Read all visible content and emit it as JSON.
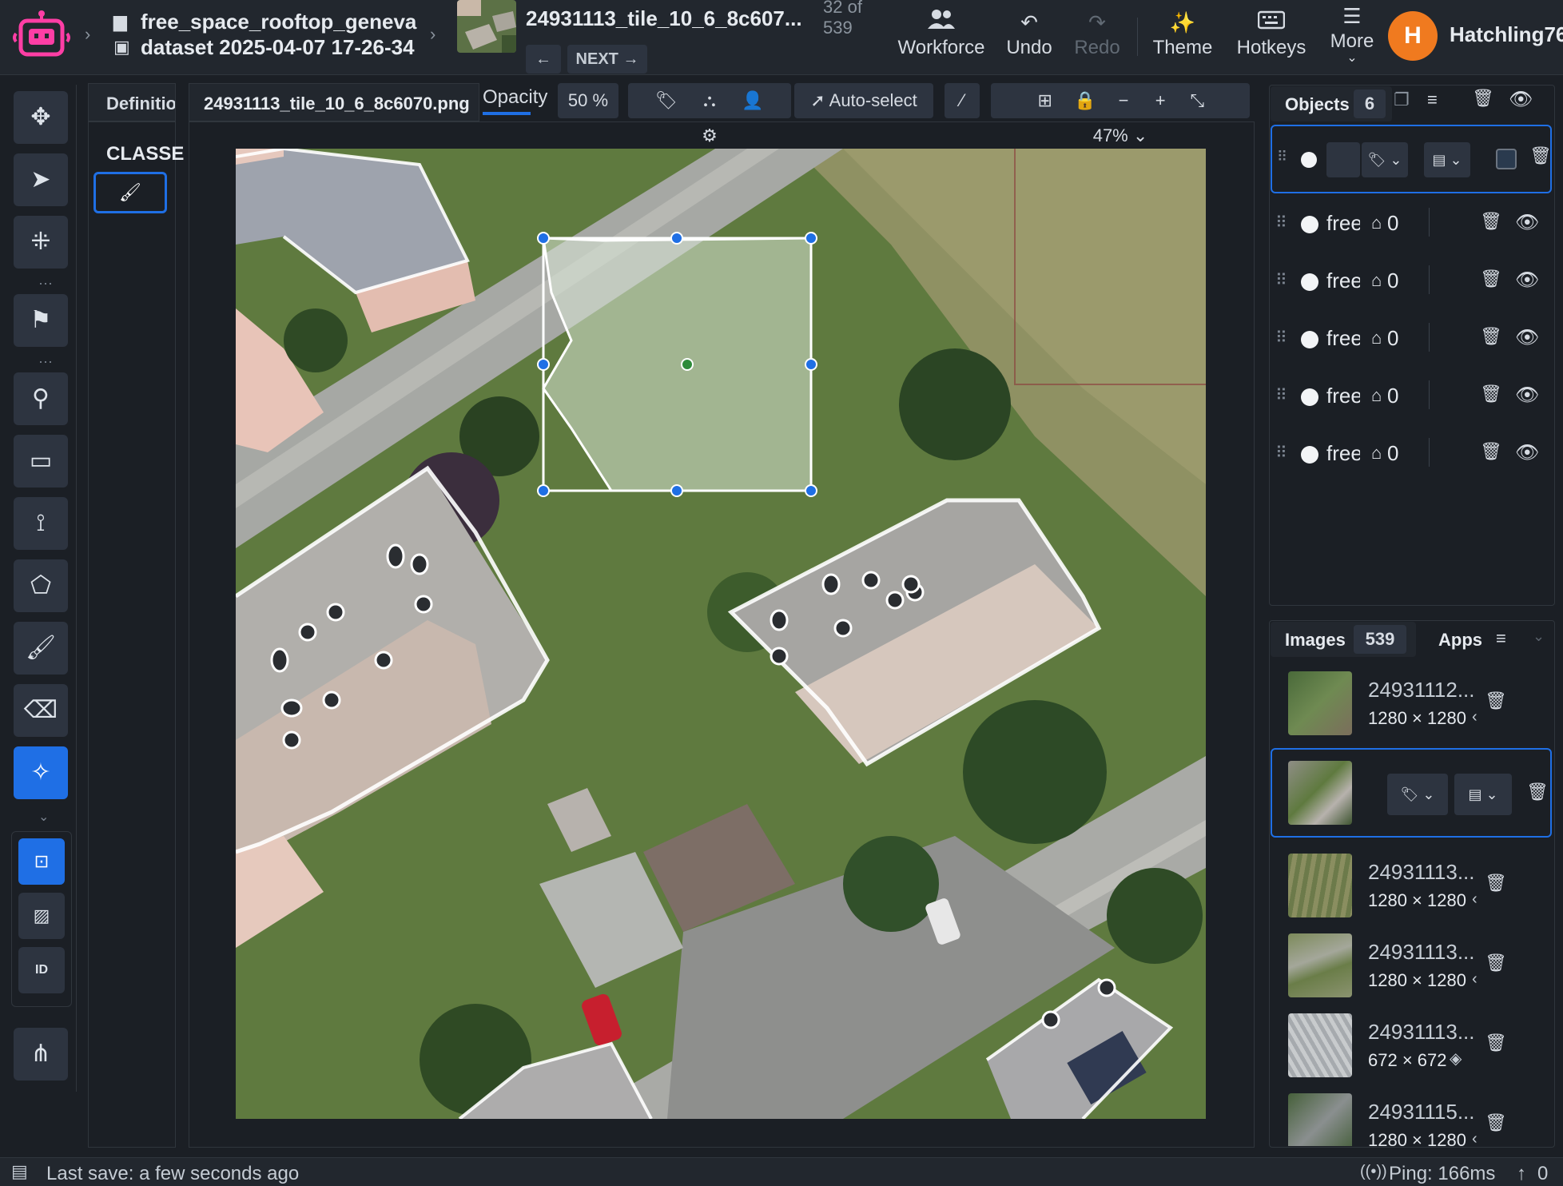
{
  "header": {
    "project": "free_space_rooftop_geneva",
    "dataset": "dataset 2025-04-07 17-26-34",
    "image_name": "24931113_tile_10_6_8c607...",
    "position": "32 of",
    "total": "539",
    "next_label": "NEXT",
    "buttons": {
      "workforce": "Workforce",
      "undo": "Undo",
      "redo": "Redo",
      "theme": "Theme",
      "hotkeys": "Hotkeys",
      "more": "More"
    },
    "user": {
      "initial": "H",
      "name": "Hatchling76"
    }
  },
  "tabs": {
    "definitions": "Definitio",
    "file": "24931113_tile_10_6_8c6070.png",
    "opacity_label": "Opacity",
    "opacity_value": "50",
    "opacity_unit": "%",
    "auto_select": "Auto-select",
    "zoom": "47%"
  },
  "classes": {
    "heading": "CLASSE"
  },
  "objects": {
    "label": "Objects",
    "count": "6",
    "rows": [
      {
        "name": "free",
        "tags": "0"
      },
      {
        "name": "free",
        "tags": "0"
      },
      {
        "name": "free",
        "tags": "0"
      },
      {
        "name": "free",
        "tags": "0"
      },
      {
        "name": "free",
        "tags": "0"
      }
    ]
  },
  "images_panel": {
    "label": "Images",
    "count": "539",
    "apps_label": "Apps",
    "items": [
      {
        "name": "24931112...",
        "size": "1280 × 1280"
      },
      {
        "name": "",
        "size": ""
      },
      {
        "name": "24931113...",
        "size": "1280 × 1280"
      },
      {
        "name": "24931113...",
        "size": "1280 × 1280"
      },
      {
        "name": "24931113...",
        "size": "672 × 672"
      },
      {
        "name": "24931115...",
        "size": "1280 × 1280"
      }
    ]
  },
  "status": {
    "last_save": "Last save: a few seconds ago",
    "ping": "Ping: 166ms",
    "uploads": "0"
  },
  "colors": {
    "accent": "#1f6fe5",
    "avatar": "#f07a1f",
    "mask_outline": "#ffffff"
  }
}
